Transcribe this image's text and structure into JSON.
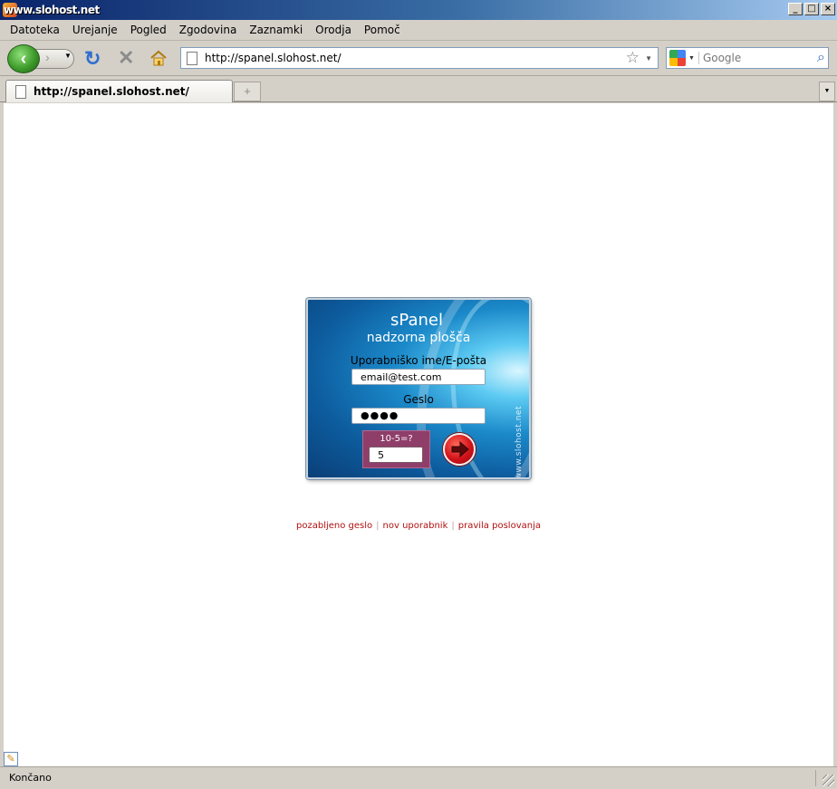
{
  "window": {
    "title": "www.slohost.net"
  },
  "menu": [
    "Datoteka",
    "Urejanje",
    "Pogled",
    "Zgodovina",
    "Zaznamki",
    "Orodja",
    "Pomoč"
  ],
  "toolbar": {
    "url": "http://spanel.slohost.net/",
    "search_placeholder": "Google"
  },
  "tabs": [
    {
      "label": "http://spanel.slohost.net/"
    }
  ],
  "login": {
    "title": "sPanel",
    "subtitle": "nadzorna plošča",
    "username_label": "Uporabniško ime/E-pošta",
    "username_value": "email@test.com",
    "password_label": "Geslo",
    "password_value": "●●●●",
    "captcha_question": "10-5=?",
    "captcha_value": "5",
    "watermark": "www.slohost.net"
  },
  "links": [
    "pozabljeno geslo",
    "nov uporabnik",
    "pravila poslovanja"
  ],
  "status": {
    "text": "Končano"
  },
  "colors": {
    "link": "#b01010",
    "panel_blue": "#1b89c9",
    "captcha_bg": "#8f3e6a",
    "go_button": "#d3131a"
  }
}
